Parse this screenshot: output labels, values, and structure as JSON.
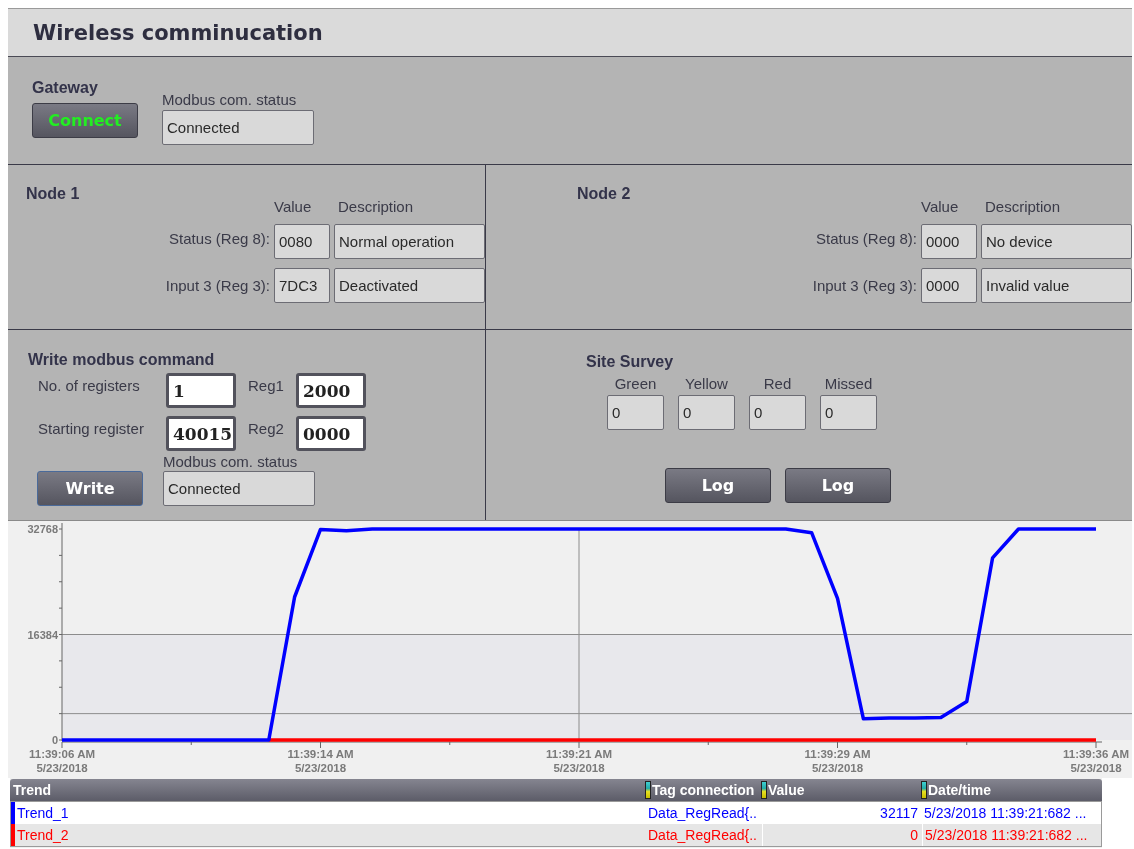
{
  "window": {
    "title": "Wireless comminucation"
  },
  "gateway": {
    "title": "Gateway",
    "connect_button": "Connect",
    "status_label": "Modbus com. status",
    "status_value": "Connected"
  },
  "nodes": [
    {
      "title": "Node 1",
      "value_header": "Value",
      "description_header": "Description",
      "rows": [
        {
          "label": "Status (Reg 8):",
          "value": "0080",
          "description": "Normal operation"
        },
        {
          "label": "Input 3 (Reg 3):",
          "value": "7DC3",
          "description": "Deactivated"
        }
      ]
    },
    {
      "title": "Node 2",
      "value_header": "Value",
      "description_header": "Description",
      "rows": [
        {
          "label": "Status (Reg 8):",
          "value": "0000",
          "description": "No device"
        },
        {
          "label": "Input 3 (Reg 3):",
          "value": "0000",
          "description": "Invalid value"
        }
      ]
    }
  ],
  "write_command": {
    "title": "Write modbus command",
    "registers_label": "No. of registers",
    "registers_value": "1",
    "reg1_label": "Reg1",
    "reg1_value": "2000",
    "start_label": "Starting register",
    "start_value": "40015",
    "reg2_label": "Reg2",
    "reg2_value": "0000",
    "status_label": "Modbus com. status",
    "write_button": "Write",
    "status_value": "Connected"
  },
  "site_survey": {
    "title": "Site Survey",
    "counters": [
      {
        "label": "Green",
        "value": "0"
      },
      {
        "label": "Yellow",
        "value": "0"
      },
      {
        "label": "Red",
        "value": "0"
      },
      {
        "label": "Missed",
        "value": "0"
      }
    ],
    "buttons": [
      "Log",
      "Log"
    ]
  },
  "trend_view": {
    "chart_data": {
      "type": "line",
      "ylim": [
        0,
        32768
      ],
      "yticks": [
        0,
        16384,
        32768
      ],
      "categories": [
        "11:39:06 AM\n5/23/2018",
        null,
        null,
        null,
        null,
        null,
        null,
        null,
        null,
        null,
        "11:39:14 AM\n5/23/2018",
        null,
        null,
        null,
        null,
        null,
        null,
        null,
        null,
        null,
        "11:39:21 AM\n5/23/2018",
        null,
        null,
        null,
        null,
        null,
        null,
        null,
        null,
        null,
        "11:39:29 AM\n5/23/2018",
        null,
        null,
        null,
        null,
        null,
        null,
        null,
        null,
        null,
        "11:39:36 AM\n5/23/2018"
      ],
      "series": [
        {
          "name": "Trend_1",
          "color": "#0000ff",
          "values": [
            0,
            0,
            0,
            0,
            0,
            0,
            0,
            0,
            0,
            22200,
            32700,
            32500,
            32768,
            32768,
            32768,
            32768,
            32768,
            32768,
            32768,
            32768,
            32768,
            32768,
            32768,
            32768,
            32768,
            32768,
            32768,
            32768,
            32768,
            32200,
            22000,
            3300,
            3400,
            3400,
            3500,
            6000,
            28300,
            32768,
            32768,
            32768,
            32768
          ]
        },
        {
          "name": "Trend_2",
          "color": "#ff0000",
          "values": [
            null,
            null,
            null,
            null,
            null,
            null,
            null,
            null,
            0,
            0,
            0,
            0,
            0,
            0,
            0,
            0,
            0,
            0,
            0,
            0,
            0,
            0,
            0,
            0,
            0,
            0,
            0,
            0,
            0,
            0,
            0,
            0,
            0,
            0,
            0,
            0,
            0,
            0,
            0,
            0,
            0
          ]
        }
      ]
    },
    "table": {
      "columns": [
        "Trend",
        "Tag connection",
        "Value",
        "Date/time"
      ],
      "rows": [
        {
          "tag": "Data_RegRead{..",
          "value": "32117",
          "datetime": "5/23/2018 11:39:21:682 ..."
        },
        {
          "tag": "Data_RegRead{..",
          "value": "0",
          "datetime": "5/23/2018 11:39:21:682 ..."
        }
      ]
    }
  }
}
